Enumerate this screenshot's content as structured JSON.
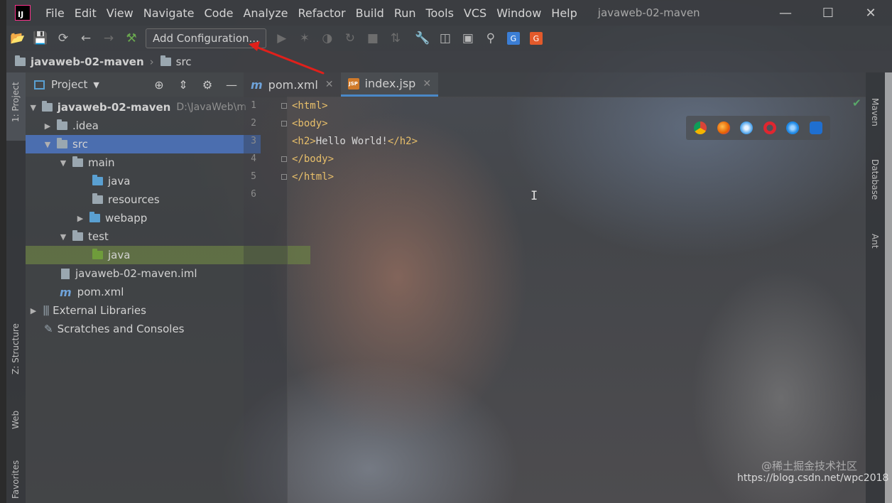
{
  "window": {
    "title": "javaweb-02-maven"
  },
  "menu": [
    "File",
    "Edit",
    "View",
    "Navigate",
    "Code",
    "Analyze",
    "Refactor",
    "Build",
    "Run",
    "Tools",
    "VCS",
    "Window",
    "Help"
  ],
  "toolbar": {
    "config_label": "Add Configuration..."
  },
  "breadcrumb": {
    "project": "javaweb-02-maven",
    "folder": "src"
  },
  "project_panel": {
    "title": "Project",
    "tree": [
      {
        "label": "javaweb-02-maven",
        "hint": "D:\\JavaWeb\\m"
      },
      {
        "label": ".idea"
      },
      {
        "label": "src"
      },
      {
        "label": "main"
      },
      {
        "label": "java"
      },
      {
        "label": "resources"
      },
      {
        "label": "webapp"
      },
      {
        "label": "test"
      },
      {
        "label": "java"
      },
      {
        "label": "javaweb-02-maven.iml"
      },
      {
        "label": "pom.xml"
      },
      {
        "label": "External Libraries"
      },
      {
        "label": "Scratches and Consoles"
      }
    ]
  },
  "left_tabs": [
    "1: Project",
    "Z: Structure",
    "Web",
    "Favorites"
  ],
  "right_tabs": [
    "Maven",
    "Database",
    "Ant"
  ],
  "editor": {
    "tabs": [
      {
        "label": "pom.xml"
      },
      {
        "label": "index.jsp"
      }
    ],
    "active_tab": "index.jsp",
    "line_numbers": [
      "1",
      "2",
      "3",
      "4",
      "5",
      "6"
    ],
    "lines": [
      "<html>",
      "<body>",
      "<h2>Hello World!</h2>",
      "</body>",
      "</html>",
      ""
    ]
  },
  "watermark": {
    "text": "https://blog.csdn.net/wpc2018",
    "text2": "@稀土掘金技术社区"
  },
  "colors": {
    "selection": "#4b6eaf",
    "tag": "#e8bf6a",
    "annotation_arrow": "#e0201b"
  }
}
